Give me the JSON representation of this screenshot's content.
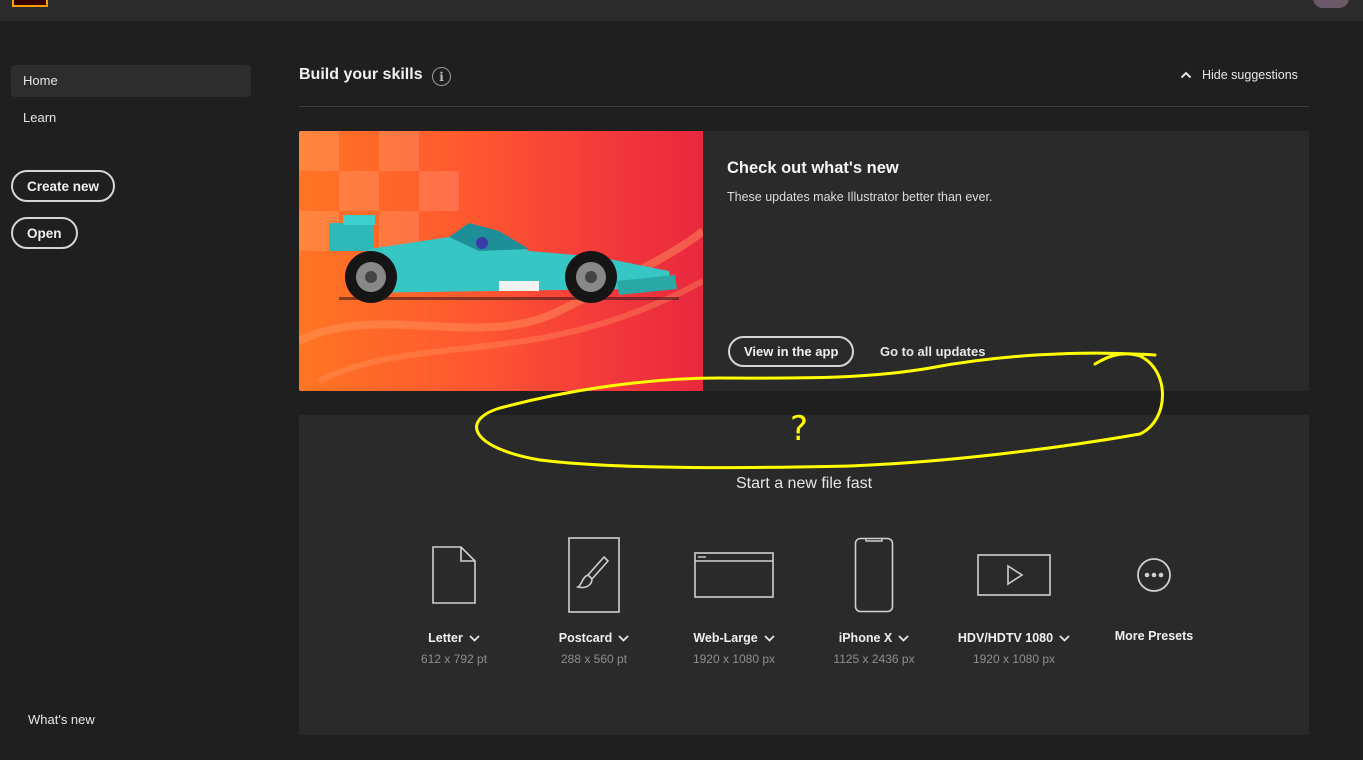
{
  "sidebar": {
    "home": "Home",
    "learn": "Learn",
    "create_new": "Create new",
    "open": "Open",
    "whats_new": "What's new"
  },
  "main": {
    "section_title": "Build your skills",
    "hide_suggestions": "Hide suggestions",
    "promo": {
      "title": "Check out what's new",
      "description": "These updates make Illustrator better than ever.",
      "view_button": "View in the app",
      "all_updates_link": "Go to all updates"
    },
    "presets": {
      "heading": "Start a new file fast",
      "items": [
        {
          "name": "Letter",
          "dims": "612 x 792 pt",
          "icon": "document-icon"
        },
        {
          "name": "Postcard",
          "dims": "288 x 560 pt",
          "icon": "postcard-brush-icon"
        },
        {
          "name": "Web-Large",
          "dims": "1920 x 1080 px",
          "icon": "browser-window-icon"
        },
        {
          "name": "iPhone X",
          "dims": "1125 x 2436 px",
          "icon": "phone-icon"
        },
        {
          "name": "HDV/HDTV 1080",
          "dims": "1920 x 1080 px",
          "icon": "video-play-icon"
        },
        {
          "name": "More Presets",
          "dims": "",
          "icon": "more-dots-icon"
        }
      ]
    }
  },
  "annotation": {
    "mark": "?",
    "color": "#ffff00"
  }
}
